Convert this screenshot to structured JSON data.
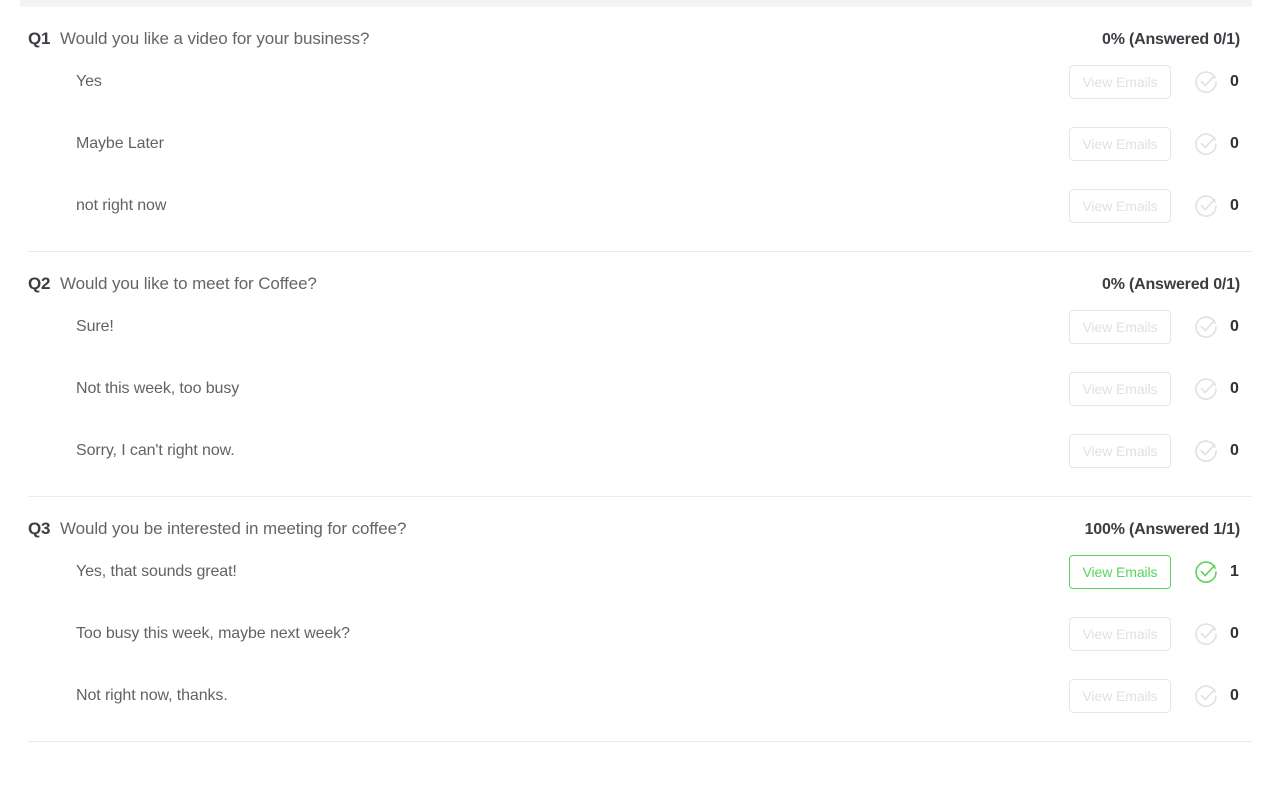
{
  "theme": {
    "accent_green": "#5ad45a",
    "muted_gray": "#dfe1e2",
    "text_dark": "#3a3d42",
    "text_body": "#5f6368",
    "divider": "#e9eaeb",
    "band": "#f1f3f4"
  },
  "labels": {
    "view_emails": "View Emails",
    "check_icon_name": "check-circle-icon"
  },
  "questions": [
    {
      "number": "Q1",
      "text": "Would you like a video for your business?",
      "stat": "0% (Answered 0/1)",
      "answers": [
        {
          "text": "Yes",
          "count": "0",
          "button": "View Emails",
          "active": false
        },
        {
          "text": "Maybe Later",
          "count": "0",
          "button": "View Emails",
          "active": false
        },
        {
          "text": "not right now",
          "count": "0",
          "button": "View Emails",
          "active": false
        }
      ]
    },
    {
      "number": "Q2",
      "text": "Would you like to meet for Coffee?",
      "stat": "0% (Answered 0/1)",
      "answers": [
        {
          "text": "Sure!",
          "count": "0",
          "button": "View Emails",
          "active": false
        },
        {
          "text": "Not this week, too busy",
          "count": "0",
          "button": "View Emails",
          "active": false
        },
        {
          "text": "Sorry, I can't right now.",
          "count": "0",
          "button": "View Emails",
          "active": false
        }
      ]
    },
    {
      "number": "Q3",
      "text": "Would you be interested in meeting for coffee?",
      "stat": "100% (Answered 1/1)",
      "answers": [
        {
          "text": "Yes, that sounds great!",
          "count": "1",
          "button": "View Emails",
          "active": true
        },
        {
          "text": "Too busy this week, maybe next week?",
          "count": "0",
          "button": "View Emails",
          "active": false
        },
        {
          "text": "Not right now, thanks.",
          "count": "0",
          "button": "View Emails",
          "active": false
        }
      ]
    }
  ]
}
